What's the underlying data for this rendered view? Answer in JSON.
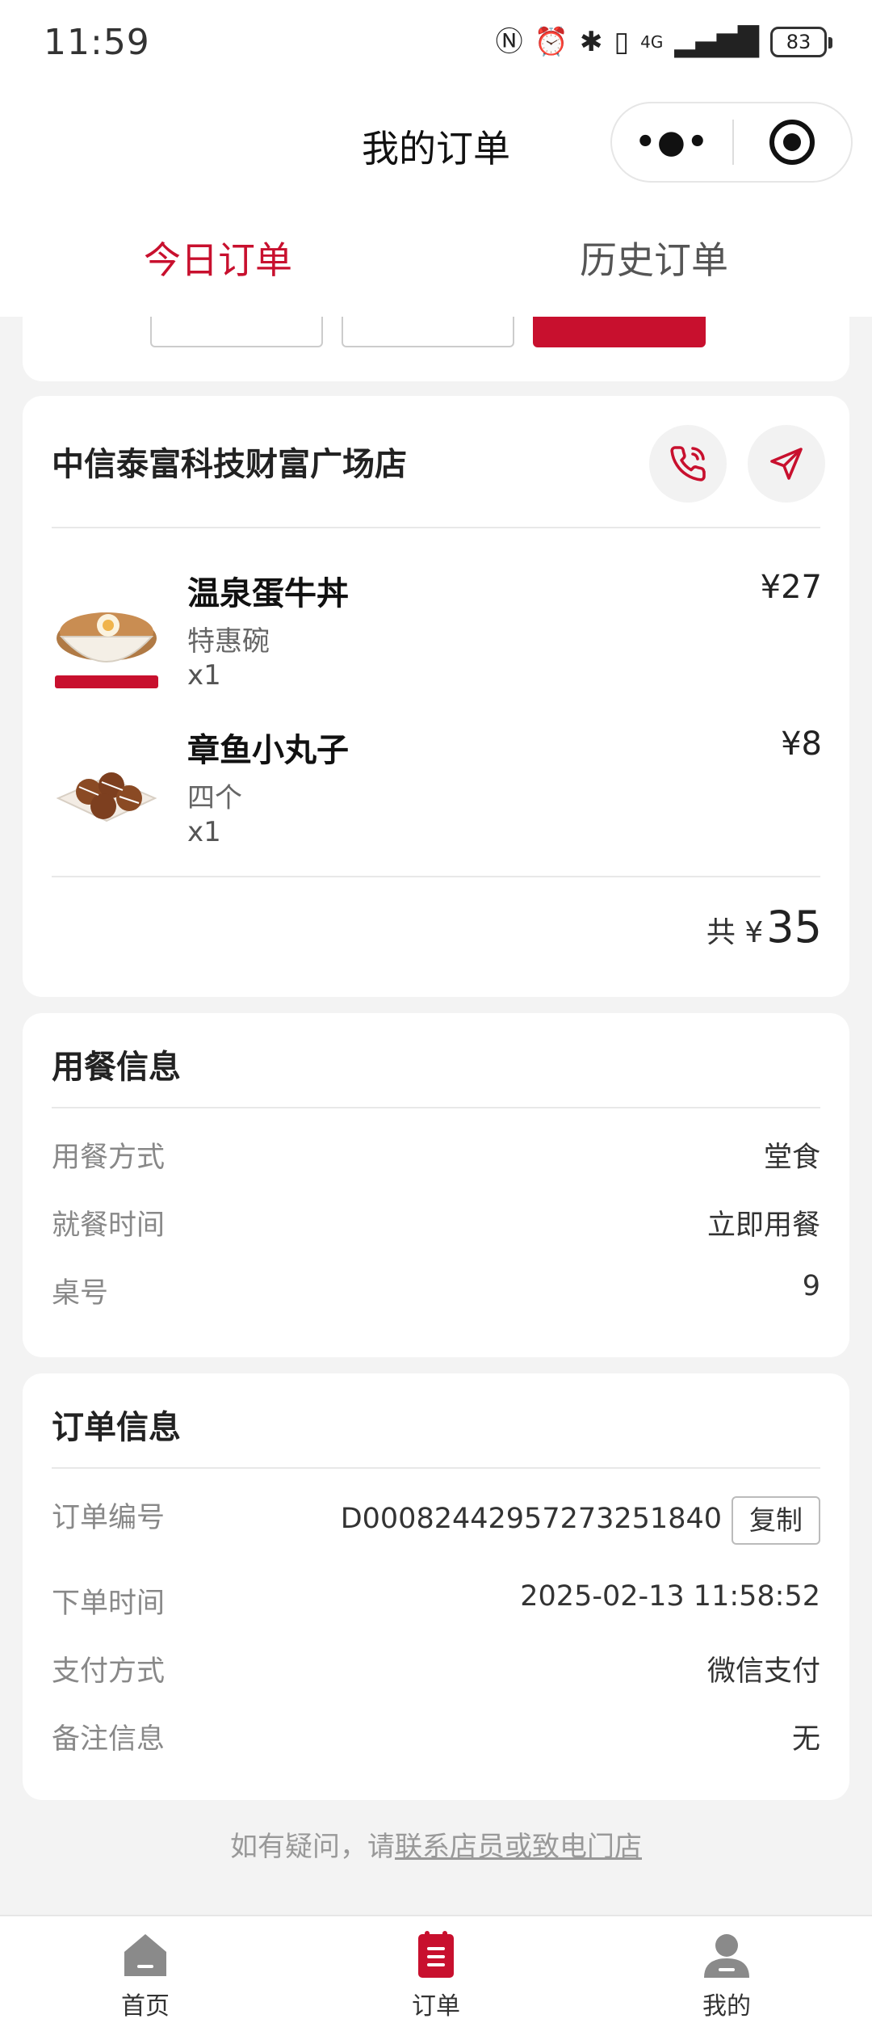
{
  "status_bar": {
    "time": "11:59",
    "network": "4G",
    "battery": "83"
  },
  "nav": {
    "title": "我的订单",
    "more_glyph": "•●•",
    "close_icon": "target-circle-icon"
  },
  "tabs": [
    {
      "label": "今日订单",
      "active": true
    },
    {
      "label": "历史订单",
      "active": false
    }
  ],
  "order": {
    "store_name": "中信泰富科技财富广场店",
    "items": [
      {
        "name": "温泉蛋牛丼",
        "spec": "特惠碗",
        "qty": "x1",
        "price": "¥27"
      },
      {
        "name": "章鱼小丸子",
        "spec": "四个",
        "qty": "x1",
        "price": "¥8"
      }
    ],
    "total_label": "共 ¥",
    "total_value": "35"
  },
  "dining_info": {
    "title": "用餐信息",
    "rows": [
      {
        "label": "用餐方式",
        "value": "堂食"
      },
      {
        "label": "就餐时间",
        "value": "立即用餐"
      },
      {
        "label": "桌号",
        "value": "9"
      }
    ]
  },
  "order_info": {
    "title": "订单信息",
    "order_no_label": "订单编号",
    "order_no": "D0008244295727325184​0",
    "copy_label": "复制",
    "rows": [
      {
        "label": "下单时间",
        "value": "2025-02-13 11:58:52"
      },
      {
        "label": "支付方式",
        "value": "微信支付"
      },
      {
        "label": "备注信息",
        "value": "无"
      }
    ]
  },
  "contact": {
    "prefix": "如有疑问，请",
    "link": "联系店员或致电门店"
  },
  "bottom_nav": [
    {
      "label": "首页",
      "icon": "home-icon",
      "active": false
    },
    {
      "label": "订单",
      "icon": "order-icon",
      "active": true
    },
    {
      "label": "我的",
      "icon": "user-icon",
      "active": false
    }
  ],
  "colors": {
    "accent": "#c8102e",
    "background": "#f3f3f3",
    "inactive_icon": "#8a8a8a"
  }
}
